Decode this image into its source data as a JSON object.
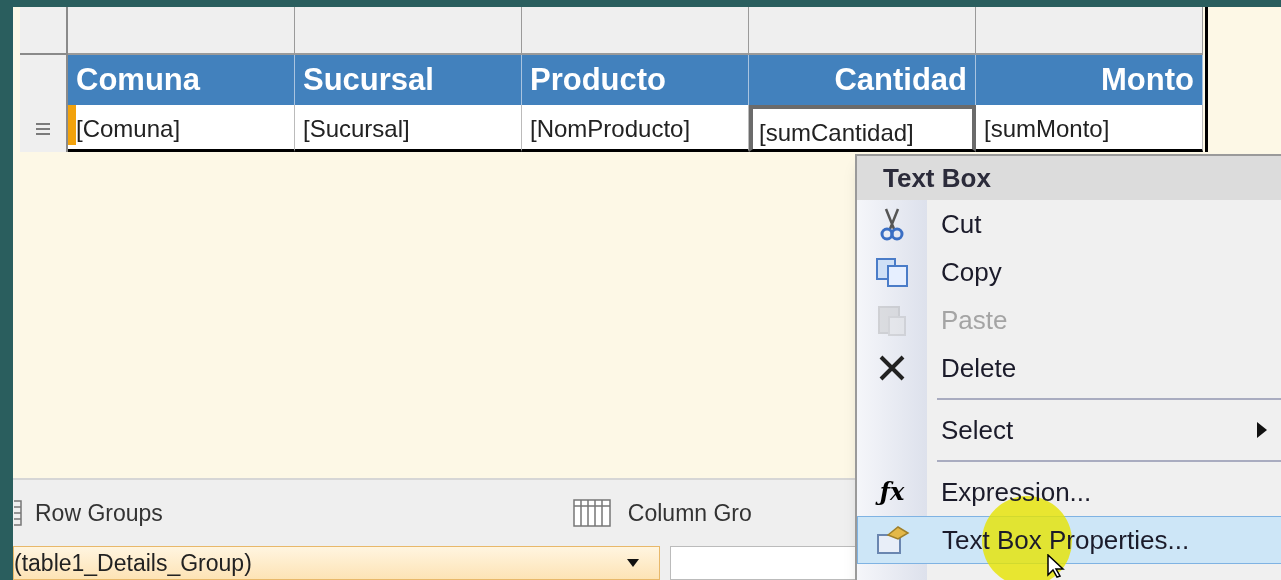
{
  "table": {
    "columns": [
      {
        "label": "Comuna",
        "kind": "text"
      },
      {
        "label": "Sucursal",
        "kind": "text"
      },
      {
        "label": "Producto",
        "kind": "text"
      },
      {
        "label": "Cantidad",
        "kind": "number"
      },
      {
        "label": "Monto",
        "kind": "number"
      }
    ],
    "cells": [
      {
        "text": "[Comuna]",
        "selected": false,
        "marker": true
      },
      {
        "text": "[Sucursal]",
        "selected": false,
        "marker": false
      },
      {
        "text": "[NomProducto]",
        "selected": false,
        "marker": false
      },
      {
        "text": "[sumCantidad]",
        "selected": true,
        "marker": false
      },
      {
        "text": "[sumMonto]",
        "selected": false,
        "marker": false
      }
    ]
  },
  "groups_panel": {
    "row_groups_label": "Row Groups",
    "column_groups_label": "Column Gro",
    "row_group": "(table1_Details_Group)"
  },
  "context_menu": {
    "title": "Text Box",
    "items": [
      {
        "kind": "item",
        "label": "Cut",
        "disabled": false,
        "selected": false
      },
      {
        "kind": "item",
        "label": "Copy",
        "disabled": false,
        "selected": false
      },
      {
        "kind": "item",
        "label": "Paste",
        "disabled": true,
        "selected": false
      },
      {
        "kind": "item",
        "label": "Delete",
        "disabled": false,
        "selected": false
      },
      {
        "kind": "separator"
      },
      {
        "kind": "submenu",
        "label": "Select",
        "disabled": false,
        "selected": false
      },
      {
        "kind": "separator"
      },
      {
        "kind": "item",
        "icon_text": "ƒx",
        "label": "Expression...",
        "disabled": false,
        "selected": false
      },
      {
        "kind": "item",
        "label": "Text Box Properties...",
        "disabled": false,
        "selected": true
      }
    ]
  }
}
